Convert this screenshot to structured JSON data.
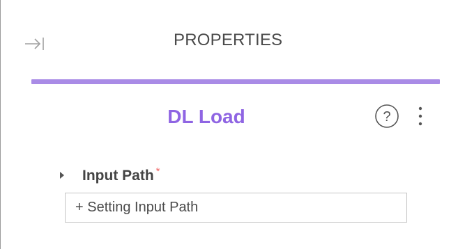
{
  "header": {
    "title": "PROPERTIES",
    "collapse_icon": "collapse-right-icon"
  },
  "component": {
    "name": "DL Load",
    "help_icon": "help-icon",
    "more_icon": "more-vertical-icon"
  },
  "sections": {
    "input_path": {
      "label": "Input Path",
      "required_mark": "*",
      "expanded": false,
      "setting_button_label": "+ Setting Input Path"
    }
  },
  "colors": {
    "accent": "#a98be6",
    "component_name": "#8f65e3",
    "required": "#f06a6a"
  }
}
